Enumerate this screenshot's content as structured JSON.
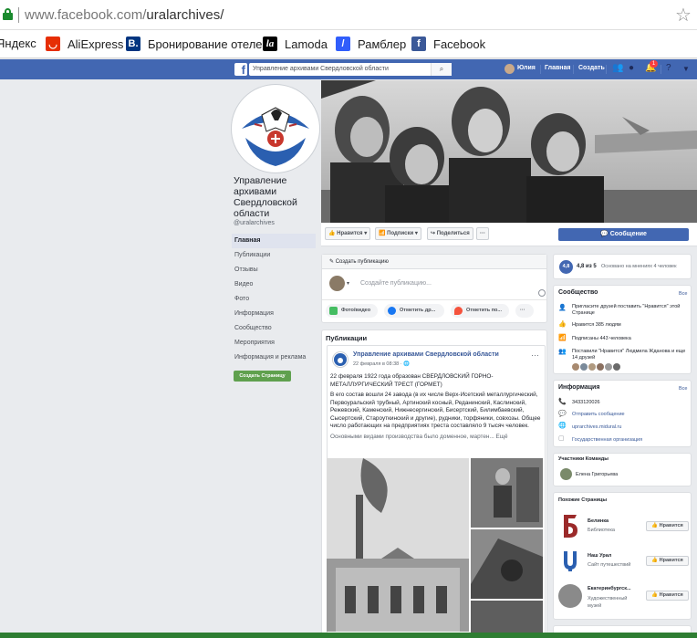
{
  "browser": {
    "url_prefix": "www.facebook.com/",
    "url_path": "uralarchives/",
    "bookmarks": [
      {
        "label": "Яндекс",
        "icon": "yandex-icon",
        "color": "#ffffff"
      },
      {
        "label": "AliExpress",
        "icon": "aliexpress-icon",
        "color": "#e62e04"
      },
      {
        "label": "Бронирование отелей",
        "icon": "booking-icon",
        "color": "#003580"
      },
      {
        "label": "Lamoda",
        "icon": "lamoda-icon",
        "color": "#000000"
      },
      {
        "label": "Рамблер",
        "icon": "rambler-icon",
        "color": "#315efb"
      },
      {
        "label": "Facebook",
        "icon": "facebook-icon",
        "color": "#3b5998"
      }
    ]
  },
  "topbar": {
    "search_value": "Управление архивами Свердловской области",
    "user_name": "Юлия",
    "home": "Главная",
    "create": "Создать",
    "notifications_count": "1"
  },
  "page": {
    "name": "Управление архивами Свердловской области",
    "handle": "@uralarchives",
    "nav": [
      "Главная",
      "Публикации",
      "Отзывы",
      "Видео",
      "Фото",
      "Информация",
      "Сообщество",
      "Мероприятия",
      "Информация и реклама"
    ],
    "create_page": "Создать Страницу"
  },
  "actions": {
    "like": "Нравится",
    "follow": "Подписки",
    "share": "Поделиться",
    "more": "···",
    "message": "Сообщение"
  },
  "composer": {
    "header": "Создать публикацию",
    "placeholder": "Создайте публикацию...",
    "photo_video": "Фото/видео",
    "tag_friends": "Отметить др...",
    "check_in": "Отметить по...",
    "more": "···"
  },
  "feed": {
    "title": "Публикации",
    "post": {
      "author": "Управление архивами Свердловской области",
      "date": "22 февраля в 08:38 ·",
      "headline": "22 февраля 1922 года образован СВЕРДЛОВСКИЙ ГОРНО-МЕТАЛЛУРГИЧЕСКИЙ ТРЕСТ (ГОРМЕТ)",
      "body": "В его состав вошли 24 завода (в их числе Верх-Исетский металлургический, Первоуральский трубный, Артинский косный, Реданинский, Каслинский, Режевский, Каменский, Нижнесергинский, Бисертский, Билимбаевский, Сысертский, Староуткинский и другие), рудники, торфяники, совхозы. Общее число работающих на предприятиях треста составляло 9 тысяч человек.",
      "more": "Основными видами производства было доменное, мартен... Ещё"
    }
  },
  "right": {
    "rating": "4,8",
    "rating_of": "из 5",
    "rating_text": "Основано на мнениях 4 человек",
    "community_title": "Сообщество",
    "all": "Все",
    "invite_text": "Пригласите друзей поставить \"Нравится\" этой Странице",
    "likes": "Нравится 385 людям",
    "followers": "Подписаны 443 человека",
    "friend_likes": "Поставили \"Нравится\" Людмила Жданова и еще 14 друзей",
    "info_title": "Информация",
    "phone": "3433120026",
    "send_message": "Отправить сообщение",
    "website": "uprarchives.midural.ru",
    "category": "Государственная организация",
    "team_title": "Участники Команды",
    "team_member": "Елена Григорьева",
    "similar_title": "Похожие Страницы",
    "similar": [
      {
        "name": "Белинка",
        "category": "Библиотека",
        "like": "Нравится"
      },
      {
        "name": "Наш Урал",
        "category": "Сайт путешествий",
        "like": "Нравится"
      },
      {
        "name": "Екатеринбургск...",
        "category": "Художественный музей",
        "like": "Нравится"
      }
    ]
  }
}
